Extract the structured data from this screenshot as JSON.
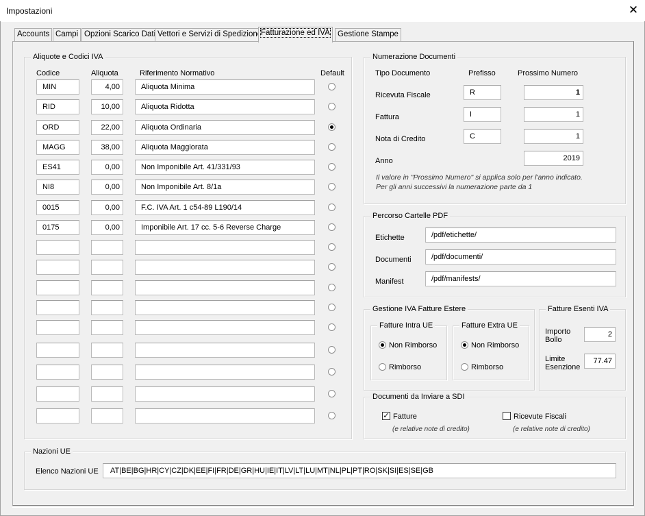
{
  "window": {
    "title": "Impostazioni",
    "close_glyph": "✕"
  },
  "tabs": [
    "Accounts",
    "Campi",
    "Opzioni Scarico Dati",
    "Vettori e Servizi di Spedizione",
    "Fatturazione ed IVA",
    "Gestione Stampe"
  ],
  "active_tab": "Fatturazione ed IVA",
  "aliquote": {
    "title": "Aliquote e Codici IVA",
    "headers": {
      "codice": "Codice",
      "aliquota": "Aliquota",
      "riferimento": "Riferimento Normativo",
      "default": "Default"
    },
    "rows": [
      {
        "codice": "MIN",
        "aliquota": "4,00",
        "riferimento": "Aliquota Minima",
        "default": false
      },
      {
        "codice": "RID",
        "aliquota": "10,00",
        "riferimento": "Aliquota Ridotta",
        "default": false
      },
      {
        "codice": "ORD",
        "aliquota": "22,00",
        "riferimento": "Aliquota Ordinaria",
        "default": true
      },
      {
        "codice": "MAGG",
        "aliquota": "38,00",
        "riferimento": "Aliquota Maggiorata",
        "default": false
      },
      {
        "codice": "ES41",
        "aliquota": "0,00",
        "riferimento": "Non Imponibile Art. 41/331/93",
        "default": false
      },
      {
        "codice": "NI8",
        "aliquota": "0,00",
        "riferimento": "Non Imponibile Art. 8/1a",
        "default": false
      },
      {
        "codice": "0015",
        "aliquota": "0,00",
        "riferimento": "F.C. IVA Art. 1 c54-89 L190/14",
        "default": false
      },
      {
        "codice": "0175",
        "aliquota": "0,00",
        "riferimento": "Imponibile Art. 17 cc. 5-6 Reverse Charge",
        "default": false
      },
      {
        "codice": "",
        "aliquota": "",
        "riferimento": "",
        "default": false
      },
      {
        "codice": "",
        "aliquota": "",
        "riferimento": "",
        "default": false
      },
      {
        "codice": "",
        "aliquota": "",
        "riferimento": "",
        "default": false
      },
      {
        "codice": "",
        "aliquota": "",
        "riferimento": "",
        "default": false
      },
      {
        "codice": "",
        "aliquota": "",
        "riferimento": "",
        "default": false
      },
      {
        "codice": "",
        "aliquota": "",
        "riferimento": "",
        "default": false
      },
      {
        "codice": "",
        "aliquota": "",
        "riferimento": "",
        "default": false
      },
      {
        "codice": "",
        "aliquota": "",
        "riferimento": "",
        "default": false
      },
      {
        "codice": "",
        "aliquota": "",
        "riferimento": "",
        "default": false
      }
    ]
  },
  "numerazione": {
    "title": "Numerazione Documenti",
    "headers": {
      "tipo": "Tipo Documento",
      "prefisso": "Prefisso",
      "prossimo": "Prossimo Numero"
    },
    "rows": [
      {
        "label": "Ricevuta Fiscale",
        "prefisso": "R",
        "numero": "1"
      },
      {
        "label": "Fattura",
        "prefisso": "I",
        "numero": "1"
      },
      {
        "label": "Nota di Credito",
        "prefisso": "C",
        "numero": "1"
      }
    ],
    "anno_label": "Anno",
    "anno": "2019",
    "note1": "Il valore in \"Prossimo Numero\" si applica solo per l'anno indicato.",
    "note2": "Per gli anni successivi la numerazione parte da 1"
  },
  "percorso": {
    "title": "Percorso Cartelle PDF",
    "rows": [
      {
        "label": "Etichette",
        "value": "/pdf/etichette/"
      },
      {
        "label": "Documenti",
        "value": "/pdf/documenti/"
      },
      {
        "label": "Manifest",
        "value": "/pdf/manifests/"
      }
    ]
  },
  "iva_estere": {
    "title": "Gestione IVA Fatture Estere",
    "intra": {
      "title": "Fatture Intra UE",
      "opt1": "Non Rimborso",
      "opt2": "Rimborso",
      "selected": "Non Rimborso"
    },
    "extra": {
      "title": "Fatture Extra UE",
      "opt1": "Non Rimborso",
      "opt2": "Rimborso",
      "selected": "Non Rimborso"
    }
  },
  "esenti": {
    "title": "Fatture Esenti IVA",
    "importo_label_1": "Importo",
    "importo_label_2": "Bollo",
    "importo": "2",
    "limite_label_1": "Limite",
    "limite_label_2": "Esenzione",
    "limite": "77.47"
  },
  "sdi": {
    "title": "Documenti da Inviare a SDI",
    "fatture": {
      "label": "Fatture",
      "checked": true,
      "note": "(e relative note di credito)"
    },
    "ricevute": {
      "label": "Ricevute Fiscali",
      "checked": false,
      "note": "(e relative note di credito)"
    }
  },
  "nazioni": {
    "title": "Nazioni UE",
    "label": "Elenco Nazioni UE",
    "value": "AT|BE|BG|HR|CY|CZ|DK|EE|FI|FR|DE|GR|HU|IE|IT|LV|LT|LU|MT|NL|PL|PT|RO|SK|SI|ES|SE|GB"
  }
}
